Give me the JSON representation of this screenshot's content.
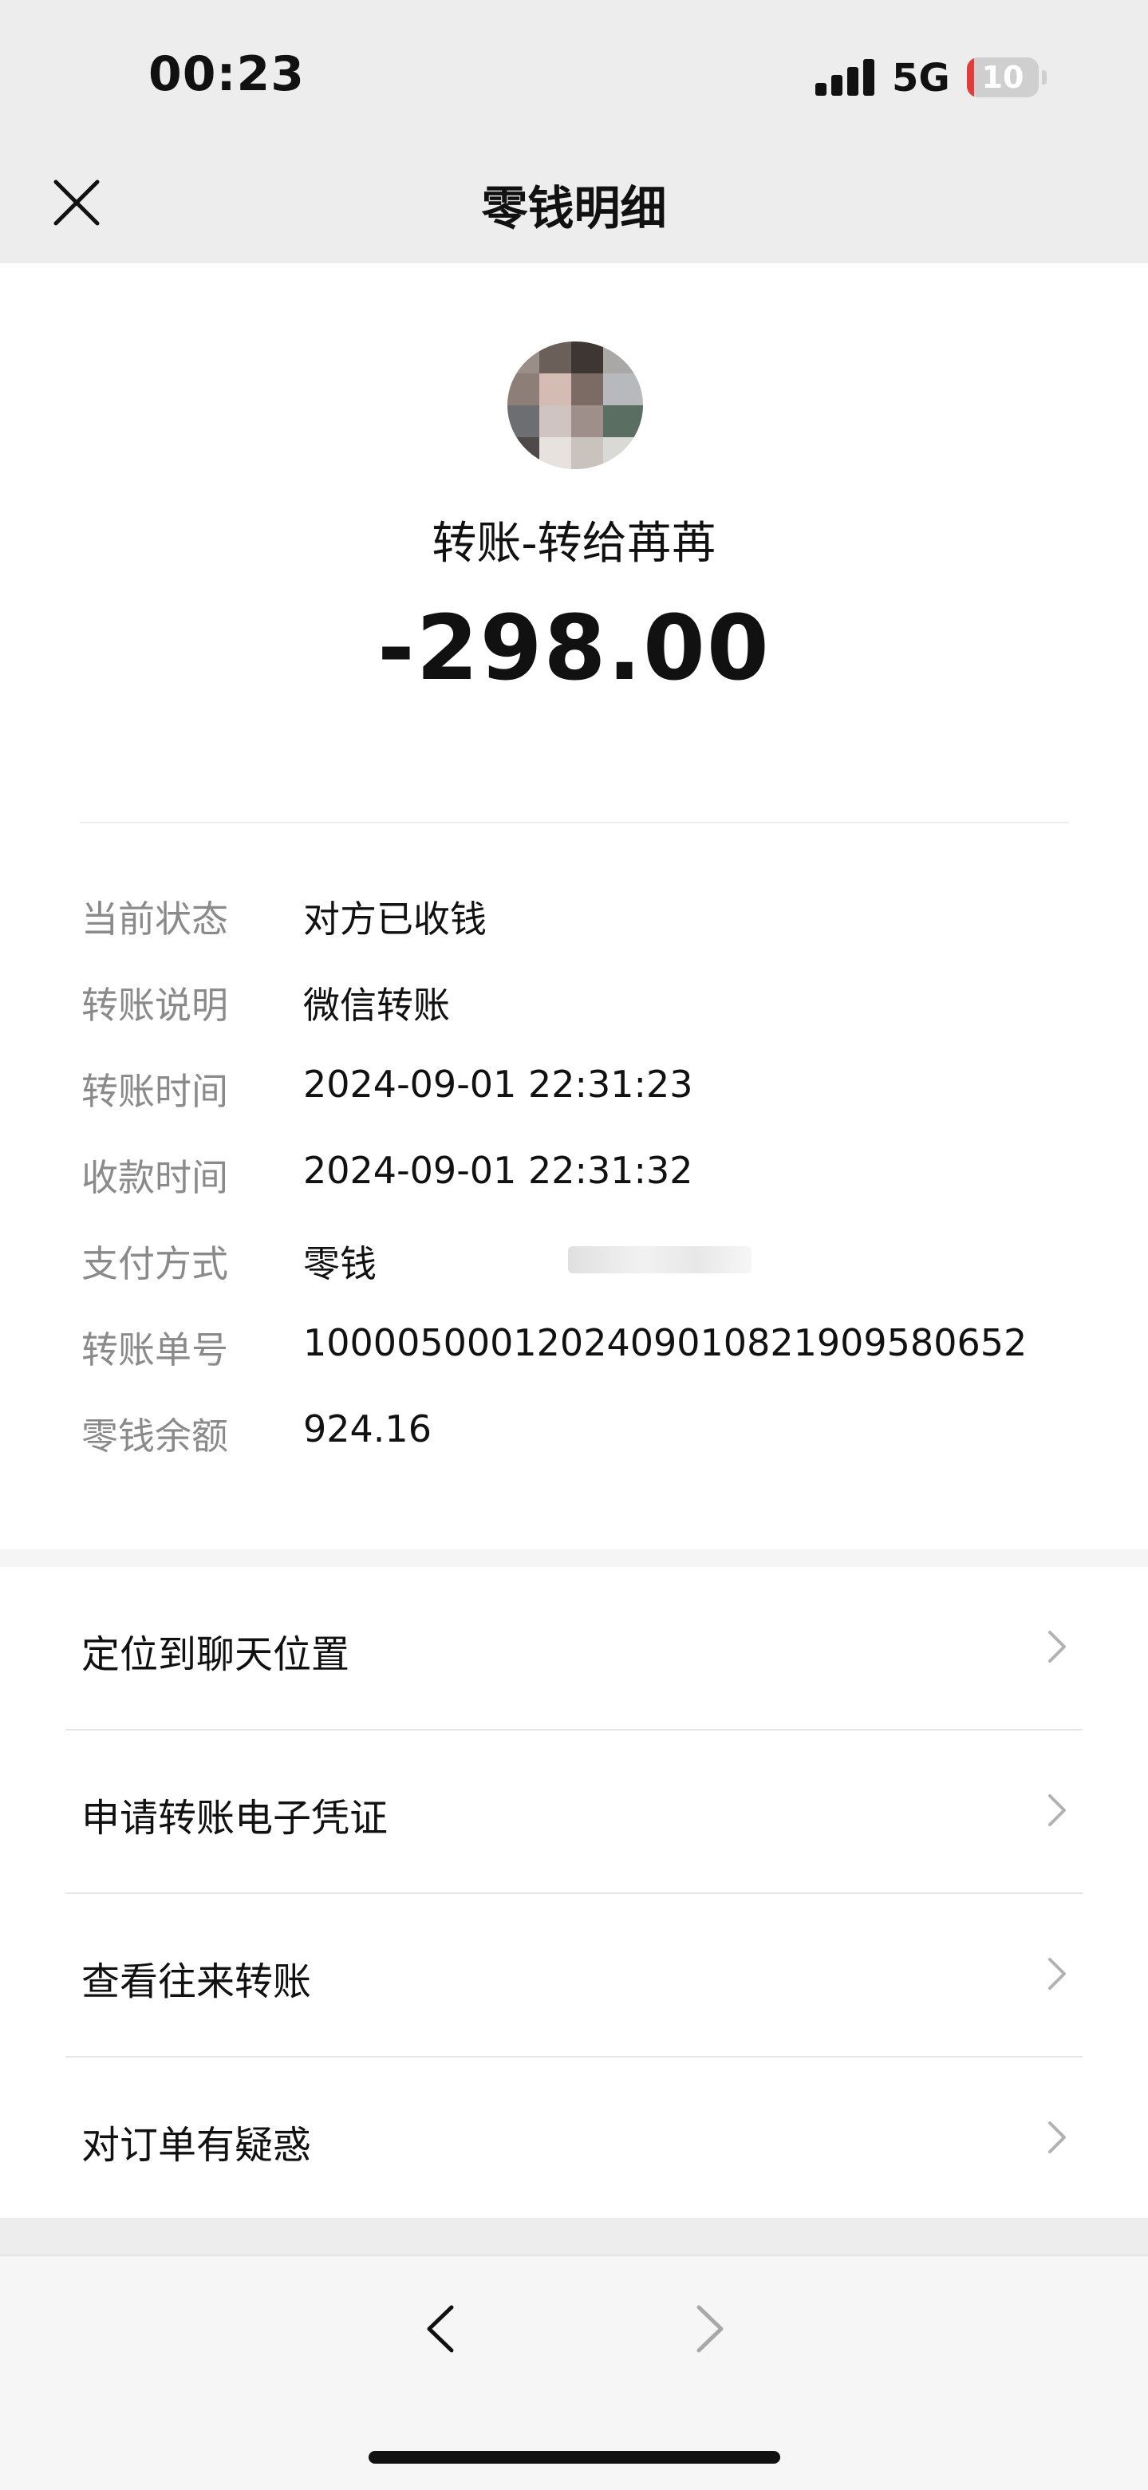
{
  "status_bar": {
    "time": "00:23",
    "network": "5G",
    "battery_level": "10",
    "battery_fraction": 0.1,
    "battery_color": "#e33b3b"
  },
  "nav": {
    "title": "零钱明细",
    "close_icon": "close-icon"
  },
  "transfer": {
    "title": "转账-转给苒苒",
    "amount": "-298.00"
  },
  "details": [
    {
      "label": "当前状态",
      "value": "对方已收钱"
    },
    {
      "label": "转账说明",
      "value": "微信转账"
    },
    {
      "label": "转账时间",
      "value": "2024-09-01 22:31:23"
    },
    {
      "label": "收款时间",
      "value": "2024-09-01 22:31:32"
    },
    {
      "label": "支付方式",
      "value": "零钱"
    },
    {
      "label": "转账单号",
      "value": "1000050001202409010821909580652"
    },
    {
      "label": "零钱余额",
      "value": "924.16"
    }
  ],
  "menu": [
    {
      "label": "定位到聊天位置",
      "icon": "chevron-right-icon"
    },
    {
      "label": "申请转账电子凭证",
      "icon": "chevron-right-icon"
    },
    {
      "label": "查看往来转账",
      "icon": "chevron-right-icon"
    },
    {
      "label": "对订单有疑惑",
      "icon": "chevron-right-icon"
    }
  ],
  "toolbar": {
    "back_icon": "chevron-left-icon",
    "forward_icon": "chevron-right-icon"
  }
}
